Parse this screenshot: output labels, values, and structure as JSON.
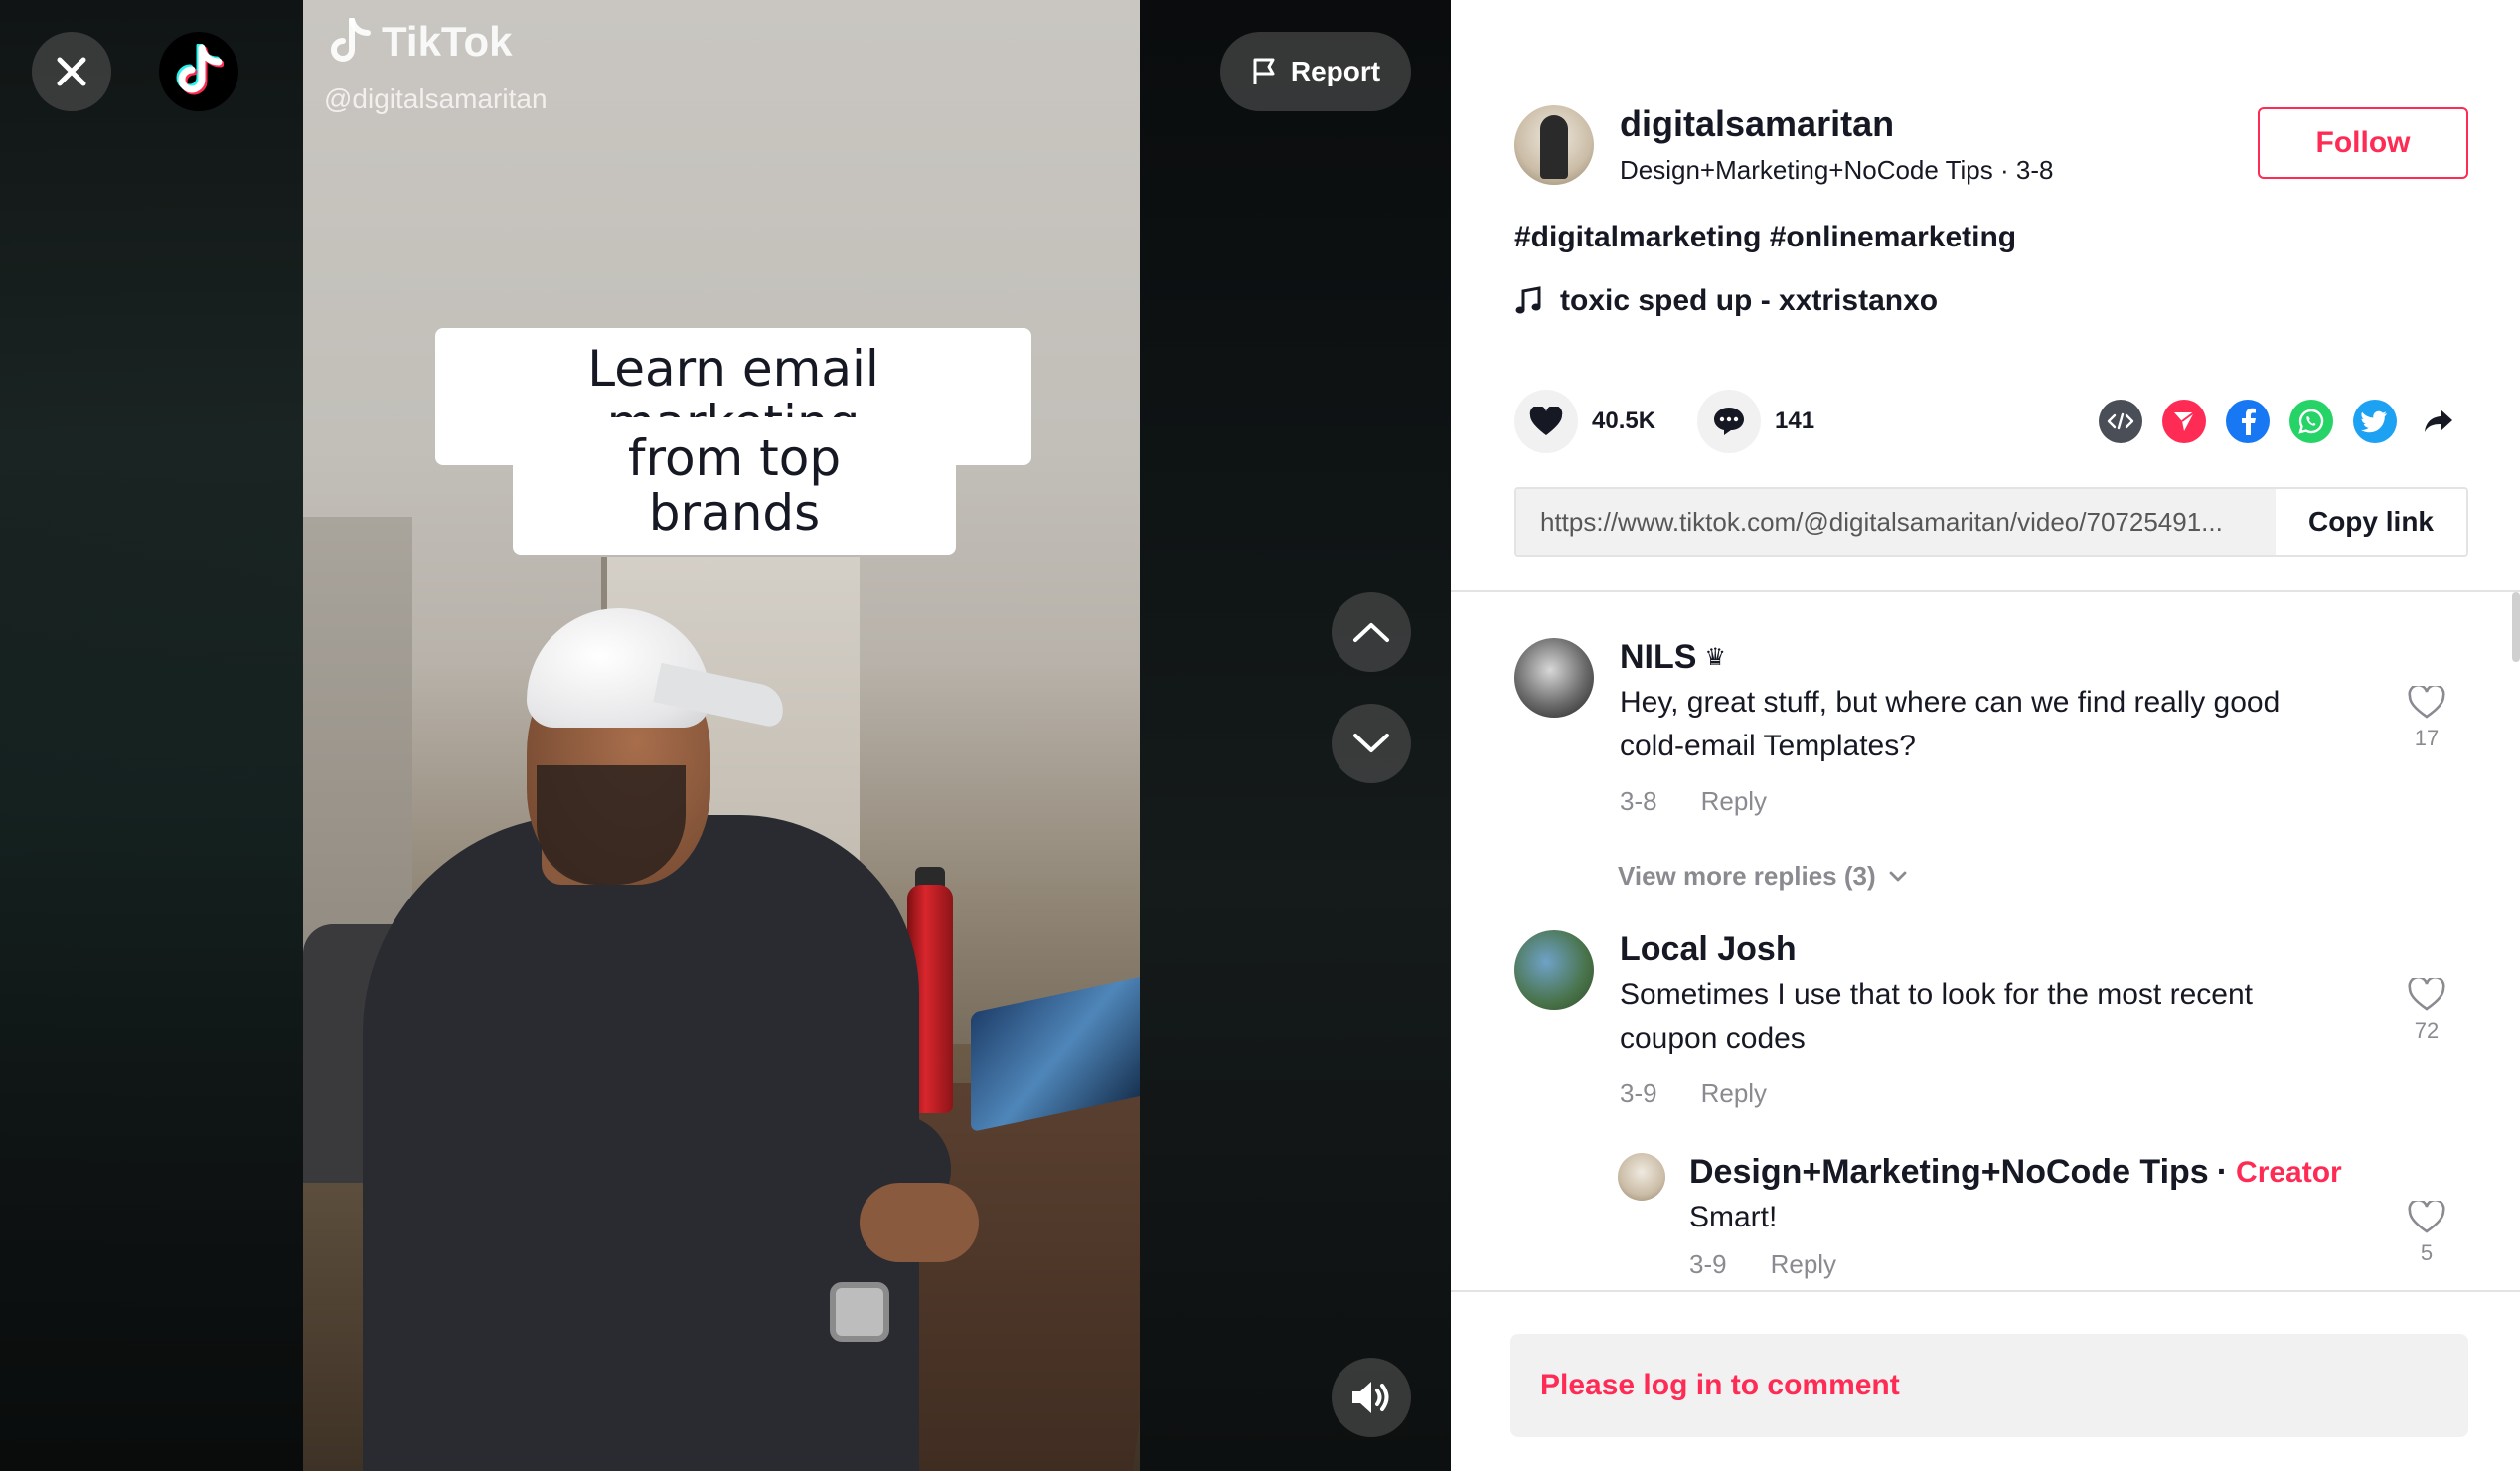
{
  "video": {
    "brand": "TikTok",
    "handle": "@digitalsamaritan",
    "caption_line1": "Learn email marketing",
    "caption_line2": "from top brands",
    "report_label": "Report"
  },
  "author": {
    "username": "digitalsamaritan",
    "nickname": "Design+Marketing+NoCode Tips",
    "date": "3-8",
    "follow_label": "Follow"
  },
  "post": {
    "description": "#digitalmarketing #onlinemarketing",
    "music": "toxic sped up - xxtristanxo",
    "likes": "40.5K",
    "comments": "141",
    "url": "https://www.tiktok.com/@digitalsamaritan/video/70725491...",
    "copy_label": "Copy link"
  },
  "share_icons": [
    "embed-icon",
    "tiktok-send-icon",
    "facebook-icon",
    "whatsapp-icon",
    "twitter-icon",
    "share-arrow-icon"
  ],
  "comments": [
    {
      "name": "NILS",
      "badge": "♛",
      "text_line1": "Hey, great stuff, but where can we find really good",
      "text_line2": "cold-email Templates?",
      "date": "3-8",
      "reply_label": "Reply",
      "likes": "17",
      "more_replies": "View more replies (3)"
    },
    {
      "name": "Local Josh",
      "text_line1": "Sometimes I use that to look for the most recent",
      "text_line2": "coupon codes",
      "date": "3-9",
      "reply_label": "Reply",
      "likes": "72"
    },
    {
      "name": "Design+Marketing+NoCode Tips",
      "separator": "·",
      "creator_label": "Creator",
      "text_line1": "Smart!",
      "date": "3-9",
      "reply_label": "Reply",
      "likes": "5"
    }
  ],
  "login_prompt": "Please log in to comment",
  "colors": {
    "accent": "#fe2c55",
    "text": "#161823",
    "muted": "#8a8b91",
    "facebook": "#1877f2",
    "whatsapp": "#25d366",
    "twitter": "#1da1f2",
    "embed": "#4a4e57"
  }
}
